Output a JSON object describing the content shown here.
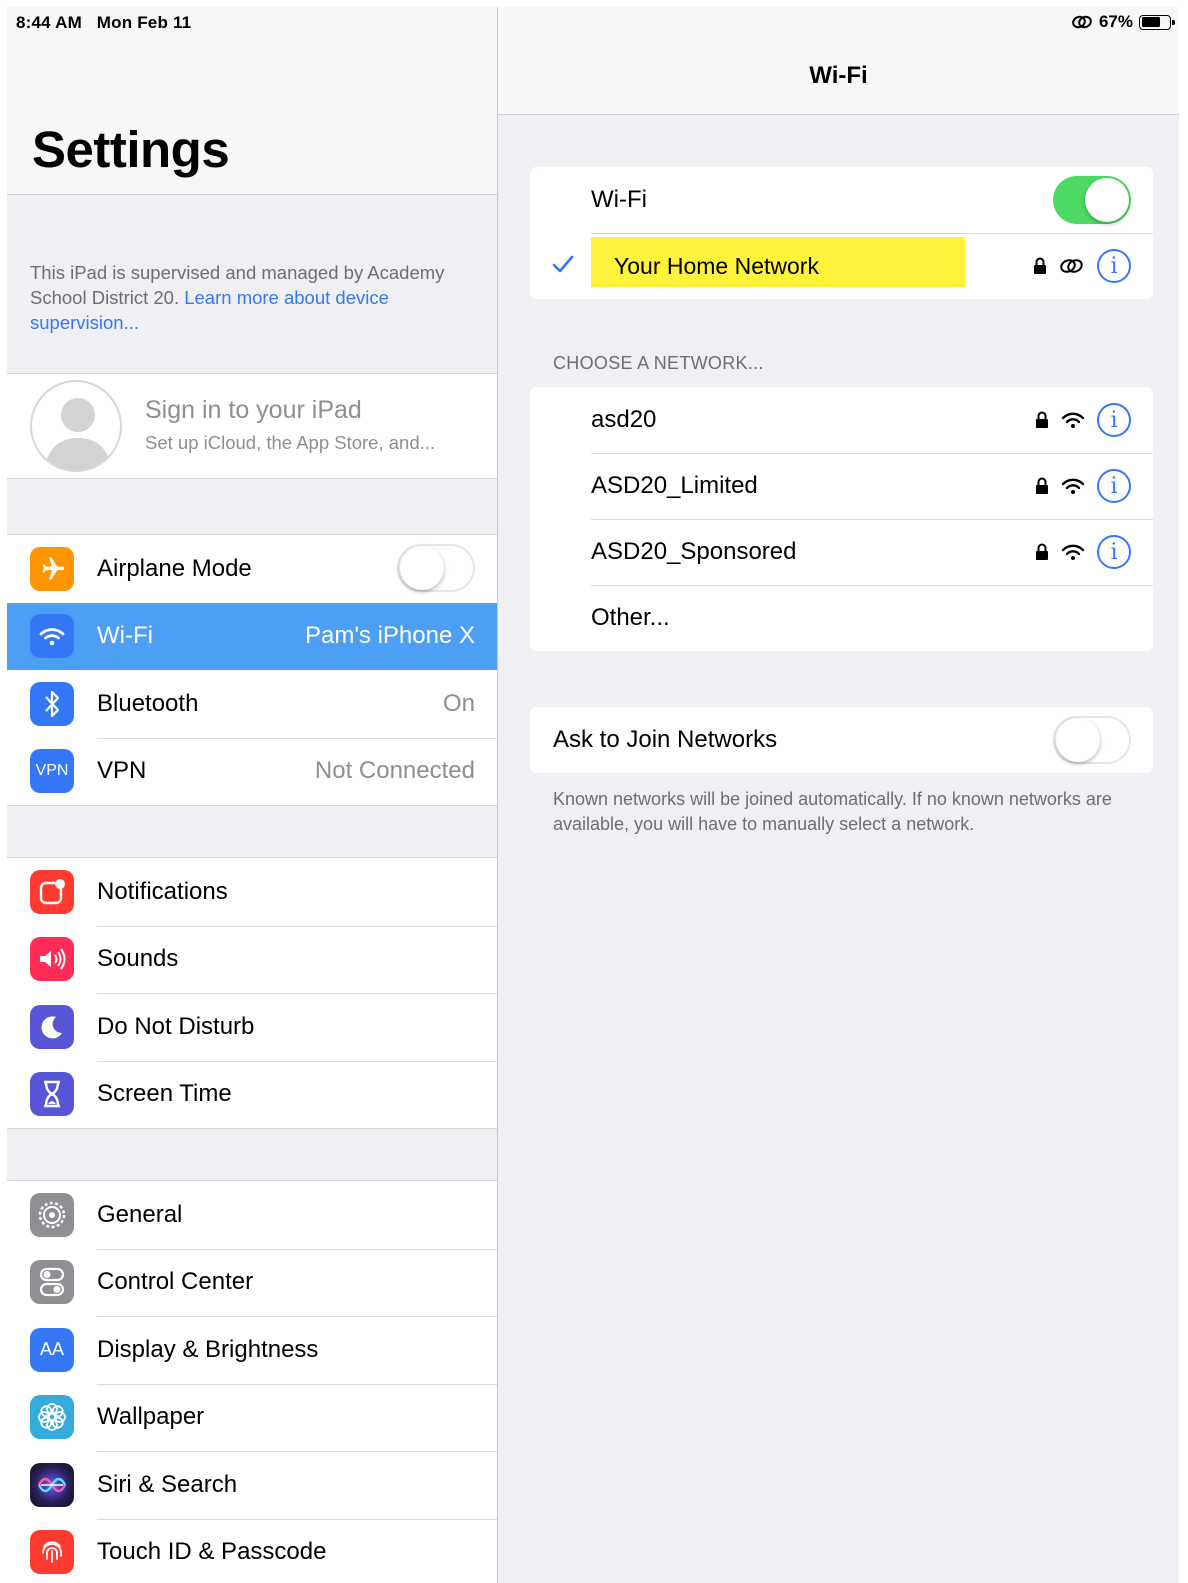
{
  "status_bar": {
    "time": "8:44 AM",
    "date": "Mon Feb 11",
    "battery_percent": "67%",
    "battery_level": 0.67
  },
  "sidebar": {
    "title": "Settings",
    "supervision_text": "This iPad is supervised and managed by Academy School District 20.",
    "supervision_link": "Learn more about device supervision...",
    "profile": {
      "title": "Sign in to your iPad",
      "subtitle": "Set up iCloud, the App Store, and..."
    },
    "group1": [
      {
        "label": "Airplane Mode",
        "icon": "airplane-icon",
        "color": "#ff9500",
        "toggle": false
      },
      {
        "label": "Wi-Fi",
        "value": "Pam's iPhone X",
        "icon": "wifi-icon",
        "color": "#3478f6",
        "selected": true
      },
      {
        "label": "Bluetooth",
        "value": "On",
        "icon": "bluetooth-icon",
        "color": "#3478f6"
      },
      {
        "label": "VPN",
        "value": "Not Connected",
        "icon": "vpn-icon",
        "icon_text": "VPN",
        "color": "#3478f6"
      }
    ],
    "group2": [
      {
        "label": "Notifications",
        "icon": "notifications-icon",
        "color": "#ff3b30"
      },
      {
        "label": "Sounds",
        "icon": "sounds-icon",
        "color": "#ff2d55"
      },
      {
        "label": "Do Not Disturb",
        "icon": "moon-icon",
        "color": "#5856d6"
      },
      {
        "label": "Screen Time",
        "icon": "hourglass-icon",
        "color": "#5856d6"
      }
    ],
    "group3": [
      {
        "label": "General",
        "icon": "gear-icon",
        "color": "#8e8e93"
      },
      {
        "label": "Control Center",
        "icon": "control-center-icon",
        "color": "#8e8e93"
      },
      {
        "label": "Display & Brightness",
        "icon": "display-icon",
        "icon_text": "AA",
        "color": "#3478f6"
      },
      {
        "label": "Wallpaper",
        "icon": "wallpaper-icon",
        "color": "#35aadc"
      },
      {
        "label": "Siri & Search",
        "icon": "siri-icon",
        "color": "#222244"
      },
      {
        "label": "Touch ID & Passcode",
        "icon": "fingerprint-icon",
        "color": "#ff3b30"
      }
    ]
  },
  "detail": {
    "title": "Wi-Fi",
    "wifi_label": "Wi-Fi",
    "wifi_on": true,
    "connected_network": "Your Home Network",
    "section_label": "CHOOSE A NETWORK...",
    "networks": [
      {
        "name": "asd20",
        "locked": true
      },
      {
        "name": "ASD20_Limited",
        "locked": true
      },
      {
        "name": "ASD20_Sponsored",
        "locked": true
      }
    ],
    "other_label": "Other...",
    "ask_to_join_label": "Ask to Join Networks",
    "ask_to_join_on": false,
    "footnote": "Known networks will be joined automatically. If no known networks are available, you will have to manually select a network."
  }
}
